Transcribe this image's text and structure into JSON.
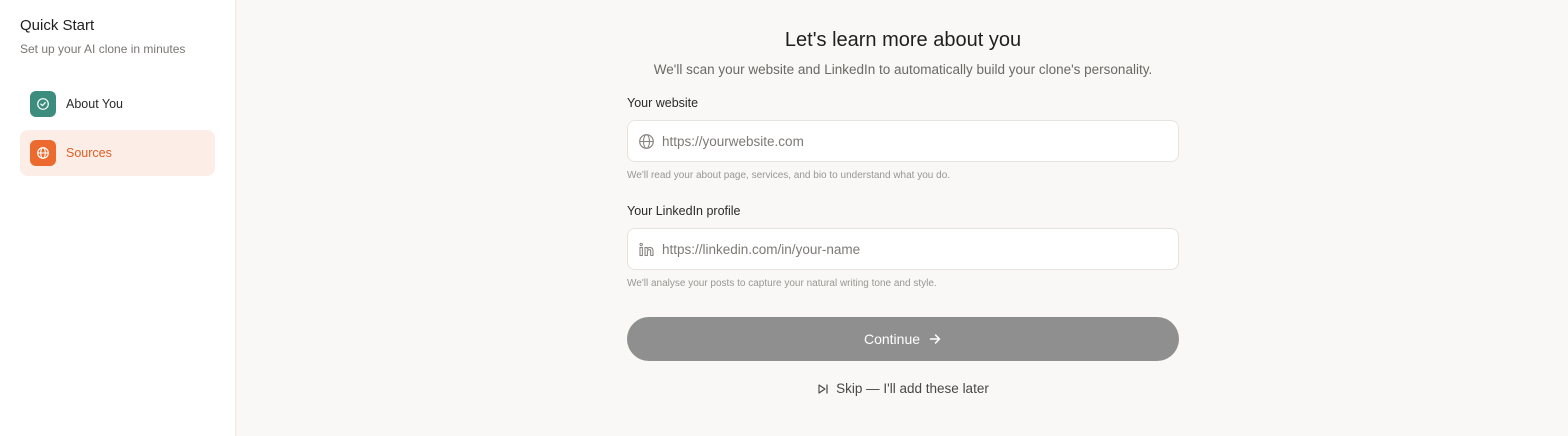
{
  "sidebar": {
    "title": "Quick Start",
    "subtitle": "Set up your AI clone in minutes",
    "steps": [
      {
        "label": "About You",
        "icon": "check-circle-icon",
        "state": "done"
      },
      {
        "label": "Sources",
        "icon": "globe-icon",
        "state": "active"
      }
    ]
  },
  "main": {
    "heading": "Let's learn more about you",
    "subheading": "We'll scan your website and LinkedIn to automatically build your clone's personality.",
    "website": {
      "label": "Your website",
      "placeholder": "https://yourwebsite.com",
      "value": "",
      "hint": "We'll read your about page, services, and bio to understand what you do.",
      "icon": "globe-icon"
    },
    "linkedin": {
      "label": "Your LinkedIn profile",
      "placeholder": "https://linkedin.com/in/your-name",
      "value": "",
      "hint": "We'll analyse your posts to capture your natural writing tone and style.",
      "icon": "linkedin-icon"
    },
    "continue_label": "Continue",
    "skip_label": "Skip — I'll add these later"
  },
  "colors": {
    "done_step": "#3d8d7e",
    "active_step": "#ec6a2e",
    "active_step_bg": "#fdede7",
    "continue_disabled": "#8f8f8f"
  }
}
